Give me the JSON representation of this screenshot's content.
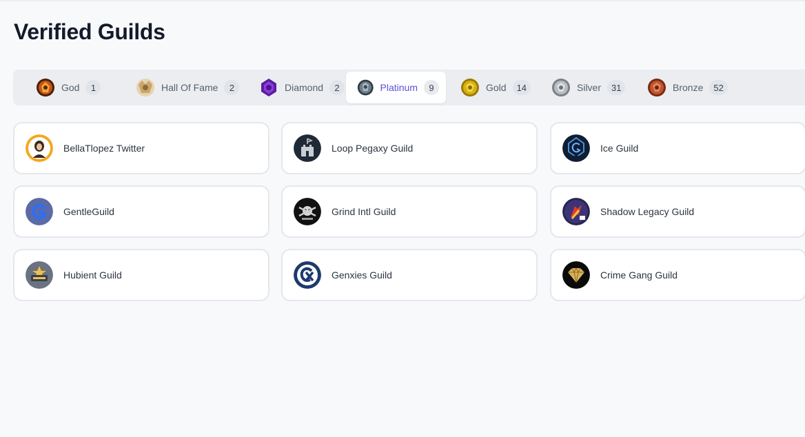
{
  "page": {
    "title": "Verified Guilds"
  },
  "tiers": [
    {
      "label": "God",
      "count": "1",
      "icon": "god-medal-icon",
      "color": "#8a3b12",
      "active": false
    },
    {
      "label": "Hall Of Fame",
      "count": "2",
      "icon": "hall-of-fame-medal-icon",
      "color": "#c9a66b",
      "active": false
    },
    {
      "label": "Diamond",
      "count": "2",
      "icon": "diamond-medal-icon",
      "color": "#7a2fc4",
      "active": false
    },
    {
      "label": "Platinum",
      "count": "9",
      "icon": "platinum-medal-icon",
      "color": "#5b6b78",
      "active": true
    },
    {
      "label": "Gold",
      "count": "14",
      "icon": "gold-medal-icon",
      "color": "#c8a008",
      "active": false
    },
    {
      "label": "Silver",
      "count": "31",
      "icon": "silver-medal-icon",
      "color": "#9aa0a6",
      "active": false
    },
    {
      "label": "Bronze",
      "count": "52",
      "icon": "bronze-medal-icon",
      "color": "#b5462a",
      "active": false
    }
  ],
  "guilds": [
    {
      "name": "BellaTlopez Twitter",
      "icon": "bellatlopez-avatar-icon"
    },
    {
      "name": "Loop Pegaxy Guild",
      "icon": "loop-pegaxy-avatar-icon"
    },
    {
      "name": "Ice Guild",
      "icon": "ice-guild-avatar-icon"
    },
    {
      "name": "GentleGuild",
      "icon": "gentleguild-avatar-icon"
    },
    {
      "name": "Grind Intl Guild",
      "icon": "grind-intl-avatar-icon"
    },
    {
      "name": "Shadow Legacy Guild",
      "icon": "shadow-legacy-avatar-icon"
    },
    {
      "name": "Hubient Guild",
      "icon": "hubient-avatar-icon"
    },
    {
      "name": "Genxies Guild",
      "icon": "genxies-avatar-icon"
    },
    {
      "name": "Crime Gang Guild",
      "icon": "crime-gang-avatar-icon"
    }
  ],
  "colors": {
    "accent": "#5b4fd8",
    "background": "#f8f9fb",
    "tab_bar": "#ebedf1"
  }
}
